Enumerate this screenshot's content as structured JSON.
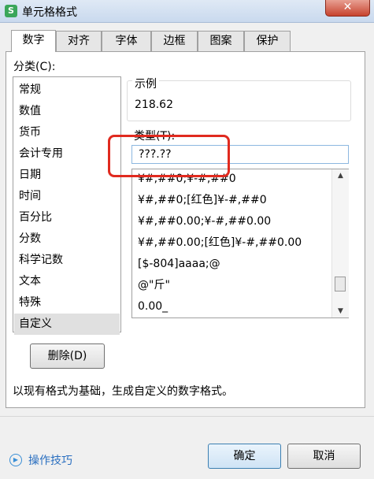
{
  "window": {
    "title": "单元格格式",
    "app_icon": "S",
    "close_glyph": "✕"
  },
  "tabs": [
    {
      "label": "数字",
      "active": true
    },
    {
      "label": "对齐"
    },
    {
      "label": "字体"
    },
    {
      "label": "边框"
    },
    {
      "label": "图案"
    },
    {
      "label": "保护"
    }
  ],
  "category": {
    "label": "分类(C):",
    "items": [
      "常规",
      "数值",
      "货币",
      "会计专用",
      "日期",
      "时间",
      "百分比",
      "分数",
      "科学记数",
      "文本",
      "特殊",
      "自定义"
    ],
    "selected": "自定义"
  },
  "sample": {
    "label": "示例",
    "value": "218.62"
  },
  "type": {
    "label": "类型(T):",
    "value": "???.??",
    "formats": [
      "¥#,##0;¥-#,##0",
      "¥#,##0;[红色]¥-#,##0",
      "¥#,##0.00;¥-#,##0.00",
      "¥#,##0.00;[红色]¥-#,##0.00",
      "[$-804]aaaa;@",
      "@\"斤\"",
      "0.00_"
    ]
  },
  "buttons": {
    "delete": "删除(D)",
    "ok": "确定",
    "cancel": "取消"
  },
  "description": "以现有格式为基础，生成自定义的数字格式。",
  "footer": {
    "tips": "操作技巧"
  },
  "colors": {
    "highlight": "#e02a1f",
    "link": "#2a6fc0"
  }
}
